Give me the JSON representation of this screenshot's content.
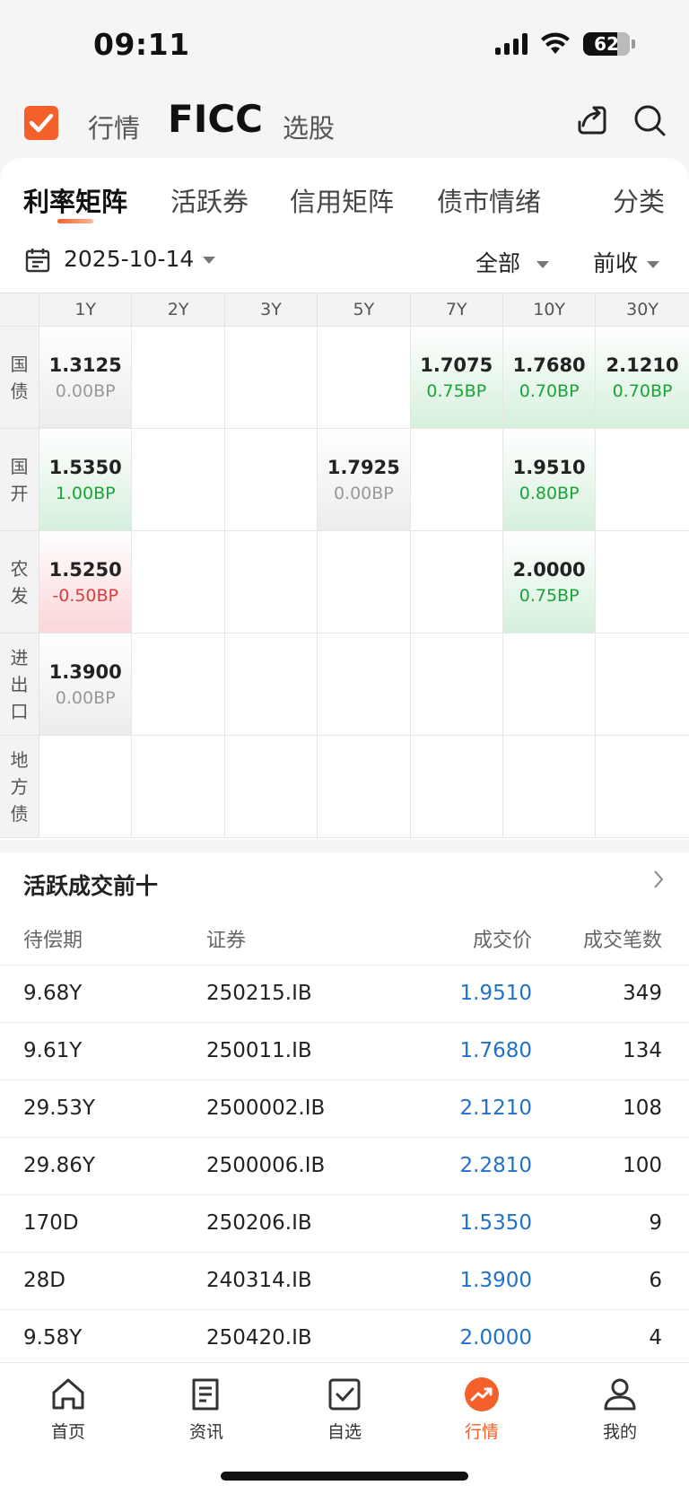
{
  "status_bar": {
    "time": "09:11",
    "battery": "62"
  },
  "top_nav": {
    "tabs": [
      {
        "label": "行情",
        "active": false
      },
      {
        "label": "FICC",
        "active": true
      },
      {
        "label": "选股",
        "active": false
      }
    ],
    "icons": [
      "share-icon",
      "search-icon"
    ]
  },
  "sub_tabs": [
    "利率矩阵",
    "活跃券",
    "信用矩阵",
    "债市情绪",
    "分类"
  ],
  "filters": {
    "date": "2025-10-14",
    "scope": "全部",
    "compare": "前收"
  },
  "matrix": {
    "columns": [
      "1Y",
      "2Y",
      "3Y",
      "5Y",
      "7Y",
      "10Y",
      "30Y"
    ],
    "rows": [
      {
        "label": [
          "国",
          "债"
        ],
        "cells": [
          {
            "yield": "1.3125",
            "bp": "0.00BP",
            "trend": "flat"
          },
          null,
          null,
          null,
          {
            "yield": "1.7075",
            "bp": "0.75BP",
            "trend": "up"
          },
          {
            "yield": "1.7680",
            "bp": "0.70BP",
            "trend": "up"
          },
          {
            "yield": "2.1210",
            "bp": "0.70BP",
            "trend": "up"
          }
        ]
      },
      {
        "label": [
          "国",
          "开"
        ],
        "cells": [
          {
            "yield": "1.5350",
            "bp": "1.00BP",
            "trend": "up"
          },
          null,
          null,
          {
            "yield": "1.7925",
            "bp": "0.00BP",
            "trend": "flat"
          },
          null,
          {
            "yield": "1.9510",
            "bp": "0.80BP",
            "trend": "up"
          },
          null
        ]
      },
      {
        "label": [
          "农",
          "发"
        ],
        "cells": [
          {
            "yield": "1.5250",
            "bp": "-0.50BP",
            "trend": "down"
          },
          null,
          null,
          null,
          null,
          {
            "yield": "2.0000",
            "bp": "0.75BP",
            "trend": "up"
          },
          null
        ]
      },
      {
        "label": [
          "进",
          "出",
          "口"
        ],
        "cells": [
          {
            "yield": "1.3900",
            "bp": "0.00BP",
            "trend": "flat"
          },
          null,
          null,
          null,
          null,
          null,
          null
        ]
      },
      {
        "label": [
          "地",
          "方",
          "债"
        ],
        "cells": [
          null,
          null,
          null,
          null,
          null,
          null,
          null
        ]
      }
    ]
  },
  "active_top10": {
    "title": "活跃成交前十",
    "headers": [
      "待偿期",
      "证券",
      "成交价",
      "成交笔数"
    ],
    "rows": [
      {
        "term": "9.68Y",
        "code": "250215.IB",
        "price": "1.9510",
        "count": "349"
      },
      {
        "term": "9.61Y",
        "code": "250011.IB",
        "price": "1.7680",
        "count": "134"
      },
      {
        "term": "29.53Y",
        "code": "2500002.IB",
        "price": "2.1210",
        "count": "108"
      },
      {
        "term": "29.86Y",
        "code": "2500006.IB",
        "price": "2.2810",
        "count": "100"
      },
      {
        "term": "170D",
        "code": "250206.IB",
        "price": "1.5350",
        "count": "9"
      },
      {
        "term": "28D",
        "code": "240314.IB",
        "price": "1.3900",
        "count": "6"
      },
      {
        "term": "9.58Y",
        "code": "250420.IB",
        "price": "2.0000",
        "count": "4"
      }
    ]
  },
  "bottom_nav": [
    {
      "label": "首页",
      "icon": "home-icon",
      "active": false
    },
    {
      "label": "资讯",
      "icon": "news-icon",
      "active": false
    },
    {
      "label": "自选",
      "icon": "watchlist-icon",
      "active": false
    },
    {
      "label": "行情",
      "icon": "market-icon",
      "active": true
    },
    {
      "label": "我的",
      "icon": "profile-icon",
      "active": false
    }
  ],
  "colors": {
    "accent": "#f4602a",
    "up": "#1aa33a",
    "down": "#e0383e",
    "price": "#1f72c7"
  }
}
